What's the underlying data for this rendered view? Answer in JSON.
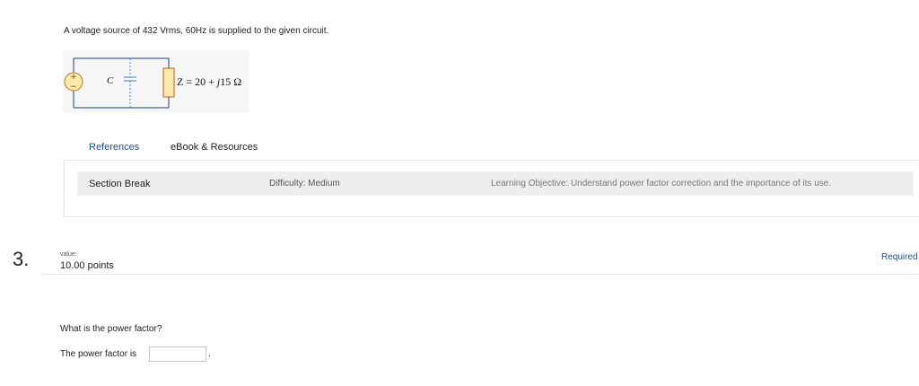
{
  "question_intro": "A voltage source of 432 Vrms, 60Hz is supplied to the given circuit.",
  "circuit": {
    "capacitor_label": "C",
    "impedance_prefix": "Z = 20 + ",
    "impedance_j": "j",
    "impedance_suffix": "15 Ω"
  },
  "tabs": [
    {
      "label": "References",
      "active": true
    },
    {
      "label": "eBook & Resources",
      "active": false
    }
  ],
  "section_bar": {
    "title": "Section Break",
    "difficulty": "Difficulty: Medium",
    "learning_objective": "Learning Objective: Understand power factor correction and the importance of its use."
  },
  "question": {
    "number": "3.",
    "value_label": "value:",
    "points": "10.00 points",
    "required_label": "Required",
    "prompt": "What is the power factor?",
    "answer_label": "The power factor is",
    "answer_value": "",
    "answer_suffix": "."
  },
  "colors": {
    "link": "#1d4f8a",
    "source_fill": "#fde9a8",
    "resistor_fill": "#fde9a8"
  }
}
